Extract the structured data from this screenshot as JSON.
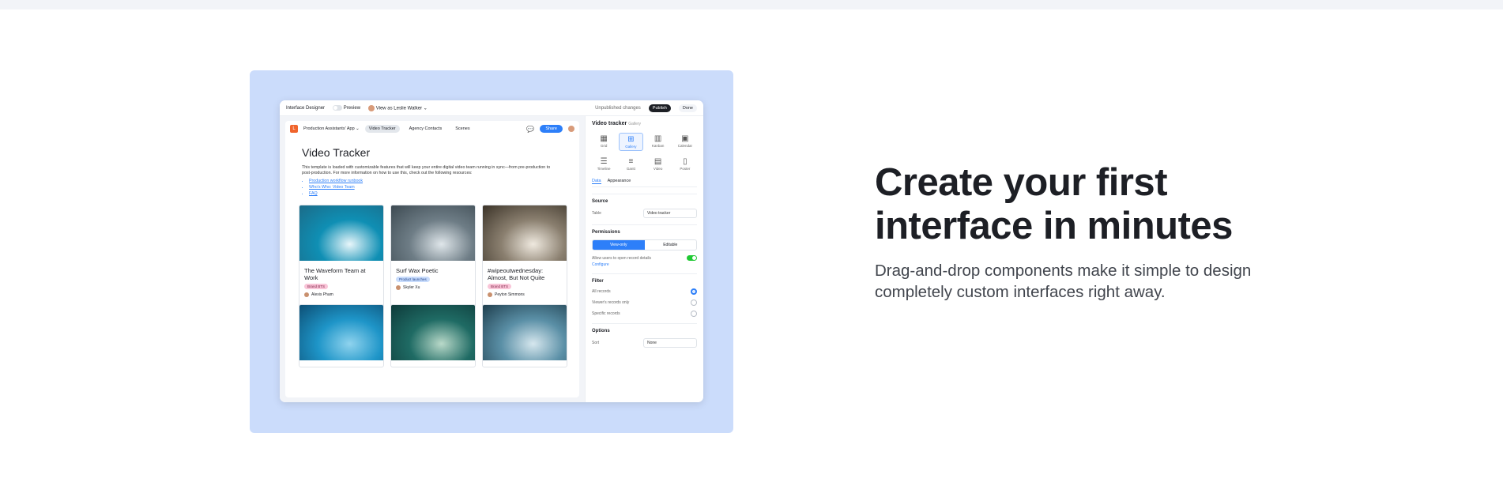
{
  "hero": {
    "headline": "Create your first interface in minutes",
    "subheadline": "Drag-and-drop components make it simple to design completely custom interfaces right away."
  },
  "designer": {
    "title": "Interface Designer",
    "preview_label": "Preview",
    "view_as": "View as Leslie Walker",
    "unpublished": "Unpublished changes",
    "publish_label": "Publish",
    "done_label": "Done"
  },
  "page": {
    "app_name": "Production Assistants' App",
    "app_logo": "L",
    "tabs": [
      "Video Tracker",
      "Agency Contacts",
      "Scenes"
    ],
    "share_label": "Share",
    "title": "Video Tracker",
    "description": "This template is loaded with customizable features that will keep your entire digital video team running in sync—from pre-production to post-production. For more information on how to use this, check out the following resources:",
    "links": [
      "Production workflow runbook",
      "Who's Who: Video Team",
      "FAQ"
    ],
    "cards": [
      {
        "title": "The Waveform Team at Work",
        "tag": "Brand BTS",
        "tag_color": "pink",
        "user": "Alexis Pham",
        "palette": [
          "#0f8fb4",
          "#e8f6fa",
          "#1b6b88"
        ]
      },
      {
        "title": "Surf Wax Poetic",
        "tag": "Product launches",
        "tag_color": "blue",
        "user": "Skyler Xu",
        "palette": [
          "#6e7d86",
          "#dfe6ea",
          "#3d4a52"
        ]
      },
      {
        "title": "#wipeoutwednesday: Almost, But Not Quite",
        "tag": "Brand BTS",
        "tag_color": "pink",
        "user": "Peyton Simmons",
        "palette": [
          "#8a7f6f",
          "#efe9df",
          "#3b3328"
        ]
      },
      {
        "title": "",
        "tag": "",
        "tag_color": "",
        "user": "",
        "palette": [
          "#1e95c8",
          "#8fd3ee",
          "#0d4f75"
        ]
      },
      {
        "title": "",
        "tag": "",
        "tag_color": "",
        "user": "",
        "palette": [
          "#1f6b64",
          "#b9d9c9",
          "#0e3a3a"
        ]
      },
      {
        "title": "",
        "tag": "",
        "tag_color": "",
        "user": "",
        "palette": [
          "#5a8fa6",
          "#d6e7ee",
          "#1f3f4e"
        ]
      }
    ]
  },
  "sidebar": {
    "title": "Video tracker",
    "subtitle": "Gallery",
    "layouts": [
      {
        "label": "Grid",
        "icon": "grid-icon",
        "glyph": "▦"
      },
      {
        "label": "Gallery",
        "icon": "gallery-icon",
        "glyph": "⊞"
      },
      {
        "label": "Kanban",
        "icon": "kanban-icon",
        "glyph": "▥"
      },
      {
        "label": "Calendar",
        "icon": "calendar-icon",
        "glyph": "▣"
      },
      {
        "label": "Timeline",
        "icon": "timeline-icon",
        "glyph": "☰"
      },
      {
        "label": "Gantt",
        "icon": "gantt-icon",
        "glyph": "≡"
      },
      {
        "label": "Video",
        "icon": "video-icon",
        "glyph": "▤"
      },
      {
        "label": "Poster",
        "icon": "poster-icon",
        "glyph": "▯"
      }
    ],
    "tabs": [
      "Data",
      "Appearance"
    ],
    "source_heading": "Source",
    "table_label": "Table",
    "table_value": "Video tracker",
    "permissions_heading": "Permissions",
    "perm_options": [
      "View-only",
      "Editable"
    ],
    "open_details_label": "Allow users to open record details",
    "configure_label": "Configure",
    "filter_heading": "Filter",
    "filter_options": [
      "All records",
      "Viewer's records only",
      "Specific records"
    ],
    "options_heading": "Options",
    "sort_label": "Sort",
    "sort_value": "None"
  },
  "colors": {
    "accent": "#2d7ff9",
    "hero_bg": "#cbdcfb",
    "toggle_on": "#20c933"
  }
}
